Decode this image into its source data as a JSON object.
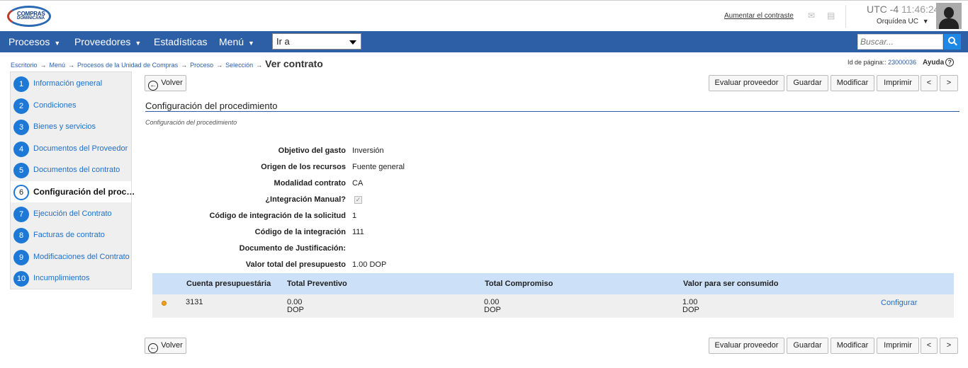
{
  "header": {
    "logo_line1": "COMPRAS",
    "logo_line2": "DOMINICANA",
    "contrast_link": "Aumentar el contraste",
    "timezone": "UTC -4",
    "time": "11:46:24",
    "user_name": "Orquídea UC",
    "icons": [
      "mail-icon",
      "calendar-icon",
      "user-avatar"
    ]
  },
  "nav": {
    "items": [
      "Procesos",
      "Proveedores",
      "Estadísticas",
      "Menú"
    ],
    "goto_value": "Ir a",
    "search_placeholder": "Buscar..."
  },
  "breadcrumb": {
    "items": [
      "Escritorio",
      "Menú",
      "Procesos de la Unidad de Compras",
      "Proceso",
      "Selección"
    ],
    "current": "Ver contrato",
    "page_id_label": "Id de página::",
    "page_id_value": "23000036",
    "help": "Ayuda"
  },
  "steps": [
    {
      "num": "1",
      "label": "Información general"
    },
    {
      "num": "2",
      "label": "Condiciones"
    },
    {
      "num": "3",
      "label": "Bienes y servicios"
    },
    {
      "num": "4",
      "label": "Documentos del Proveedor"
    },
    {
      "num": "5",
      "label": "Documentos del contrato"
    },
    {
      "num": "6",
      "label": "Configuración del proc…",
      "active": true
    },
    {
      "num": "7",
      "label": "Ejecución del Contrato"
    },
    {
      "num": "8",
      "label": "Facturas de contrato"
    },
    {
      "num": "9",
      "label": "Modificaciones del Contrato"
    },
    {
      "num": "10",
      "label": "Incumplimientos"
    }
  ],
  "toolbar": {
    "back": "Volver",
    "evaluate": "Evaluar proveedor",
    "save": "Guardar",
    "modify": "Modificar",
    "print": "Imprimir",
    "prev": "<",
    "next": ">"
  },
  "section": {
    "title": "Configuración del procedimiento",
    "subtitle": "Configuración del procedimiento"
  },
  "fields": [
    {
      "label": "Objetivo del gasto",
      "value": "Inversión"
    },
    {
      "label": "Origen de los recursos",
      "value": "Fuente general"
    },
    {
      "label": "Modalidad contrato",
      "value": "CA"
    },
    {
      "label": "¿Integración Manual?",
      "value": "",
      "checked": true
    },
    {
      "label": "Código de integración de la solicitud",
      "value": "1"
    },
    {
      "label": "Código de la integración",
      "value": "111"
    },
    {
      "label": "Documento de Justificación:",
      "value": ""
    },
    {
      "label": "Valor total del presupuesto",
      "value": "1.00 DOP"
    }
  ],
  "budget_table": {
    "headers": [
      "Cuenta presupuestária",
      "Total Preventivo",
      "Total Compromiso",
      "Valor para ser consumido"
    ],
    "rows": [
      {
        "account": "3131",
        "preventive": "0.00",
        "preventive_cur": "DOP",
        "commitment": "0.00",
        "commitment_cur": "DOP",
        "to_consume": "1.00",
        "to_consume_cur": "DOP",
        "action": "Configurar",
        "status_color": "#f0a020"
      }
    ]
  },
  "colors": {
    "navbar": "#2c5fa6",
    "link": "#1e6fc8",
    "table_header": "#cce0f7",
    "step_circle": "#1e78d6"
  }
}
